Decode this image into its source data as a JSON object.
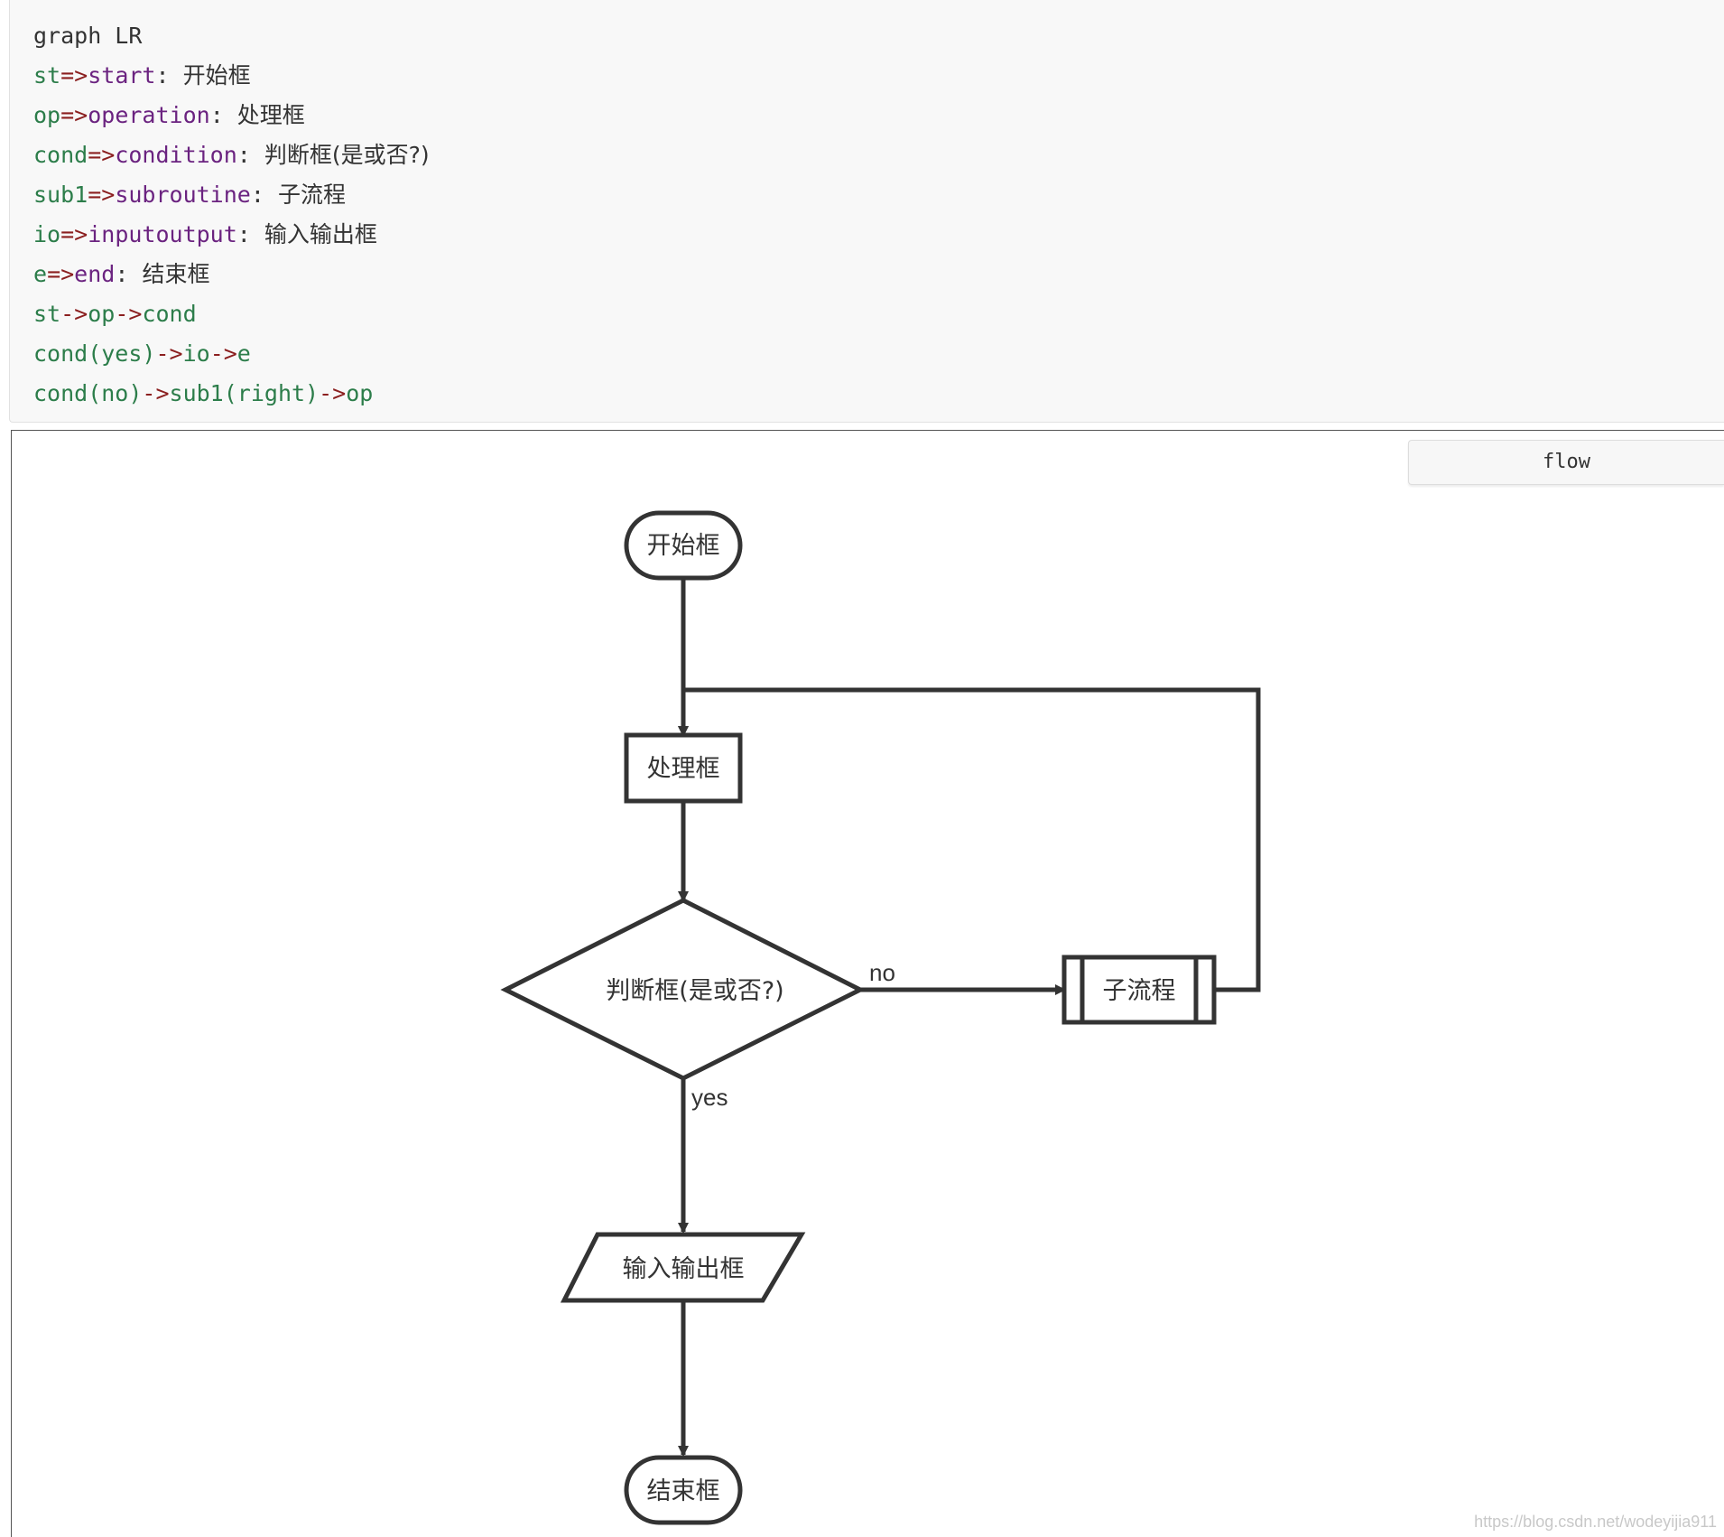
{
  "code": {
    "lines": [
      [
        {
          "t": "graph LR",
          "c": "plain"
        }
      ],
      [
        {
          "t": "st",
          "c": "var"
        },
        {
          "t": "=>",
          "c": "op"
        },
        {
          "t": "start",
          "c": "kw"
        },
        {
          "t": ": ",
          "c": "punc"
        },
        {
          "t": "开始框",
          "c": "text"
        }
      ],
      [
        {
          "t": "op",
          "c": "var"
        },
        {
          "t": "=>",
          "c": "op"
        },
        {
          "t": "operation",
          "c": "kw"
        },
        {
          "t": ": ",
          "c": "punc"
        },
        {
          "t": "处理框",
          "c": "text"
        }
      ],
      [
        {
          "t": "cond",
          "c": "var"
        },
        {
          "t": "=>",
          "c": "op"
        },
        {
          "t": "condition",
          "c": "kw"
        },
        {
          "t": ": ",
          "c": "punc"
        },
        {
          "t": "判断框(是或否?)",
          "c": "text"
        }
      ],
      [
        {
          "t": "sub1",
          "c": "var"
        },
        {
          "t": "=>",
          "c": "op"
        },
        {
          "t": "subroutine",
          "c": "kw"
        },
        {
          "t": ": ",
          "c": "punc"
        },
        {
          "t": "子流程",
          "c": "text"
        }
      ],
      [
        {
          "t": "io",
          "c": "var"
        },
        {
          "t": "=>",
          "c": "op"
        },
        {
          "t": "inputoutput",
          "c": "kw"
        },
        {
          "t": ": ",
          "c": "punc"
        },
        {
          "t": "输入输出框",
          "c": "text"
        }
      ],
      [
        {
          "t": "e",
          "c": "var"
        },
        {
          "t": "=>",
          "c": "op"
        },
        {
          "t": "end",
          "c": "kw"
        },
        {
          "t": ": ",
          "c": "punc"
        },
        {
          "t": "结束框",
          "c": "text"
        }
      ],
      [
        {
          "t": "st",
          "c": "var"
        },
        {
          "t": "->",
          "c": "arrow"
        },
        {
          "t": "op",
          "c": "var"
        },
        {
          "t": "->",
          "c": "arrow"
        },
        {
          "t": "cond",
          "c": "var"
        }
      ],
      [
        {
          "t": "cond(yes)",
          "c": "var"
        },
        {
          "t": "->",
          "c": "arrow"
        },
        {
          "t": "io",
          "c": "var"
        },
        {
          "t": "->",
          "c": "arrow"
        },
        {
          "t": "e",
          "c": "var"
        }
      ],
      [
        {
          "t": "cond(no)",
          "c": "var"
        },
        {
          "t": "->",
          "c": "arrow"
        },
        {
          "t": "sub1(right)",
          "c": "var"
        },
        {
          "t": "->",
          "c": "arrow"
        },
        {
          "t": "op",
          "c": "var"
        }
      ]
    ]
  },
  "lang_tab": {
    "label": "flow"
  },
  "flowchart": {
    "nodes": {
      "start": {
        "label": "开始框",
        "kind": "start"
      },
      "operation": {
        "label": "处理框",
        "kind": "operation"
      },
      "condition": {
        "label": "判断框(是或否?)",
        "kind": "condition"
      },
      "subroutine": {
        "label": "子流程",
        "kind": "subroutine"
      },
      "inputoutput": {
        "label": "输入输出框",
        "kind": "inputoutput"
      },
      "end": {
        "label": "结束框",
        "kind": "end"
      }
    },
    "edges": [
      {
        "from": "start",
        "to": "operation",
        "label": ""
      },
      {
        "from": "operation",
        "to": "condition",
        "label": ""
      },
      {
        "from": "condition",
        "to": "subroutine",
        "label": "no"
      },
      {
        "from": "subroutine",
        "to": "operation",
        "label": ""
      },
      {
        "from": "condition",
        "to": "inputoutput",
        "label": "yes"
      },
      {
        "from": "inputoutput",
        "to": "end",
        "label": ""
      }
    ],
    "stroke_color": "#333333"
  },
  "watermark": {
    "text": "https://blog.csdn.net/wodeyijia911"
  }
}
